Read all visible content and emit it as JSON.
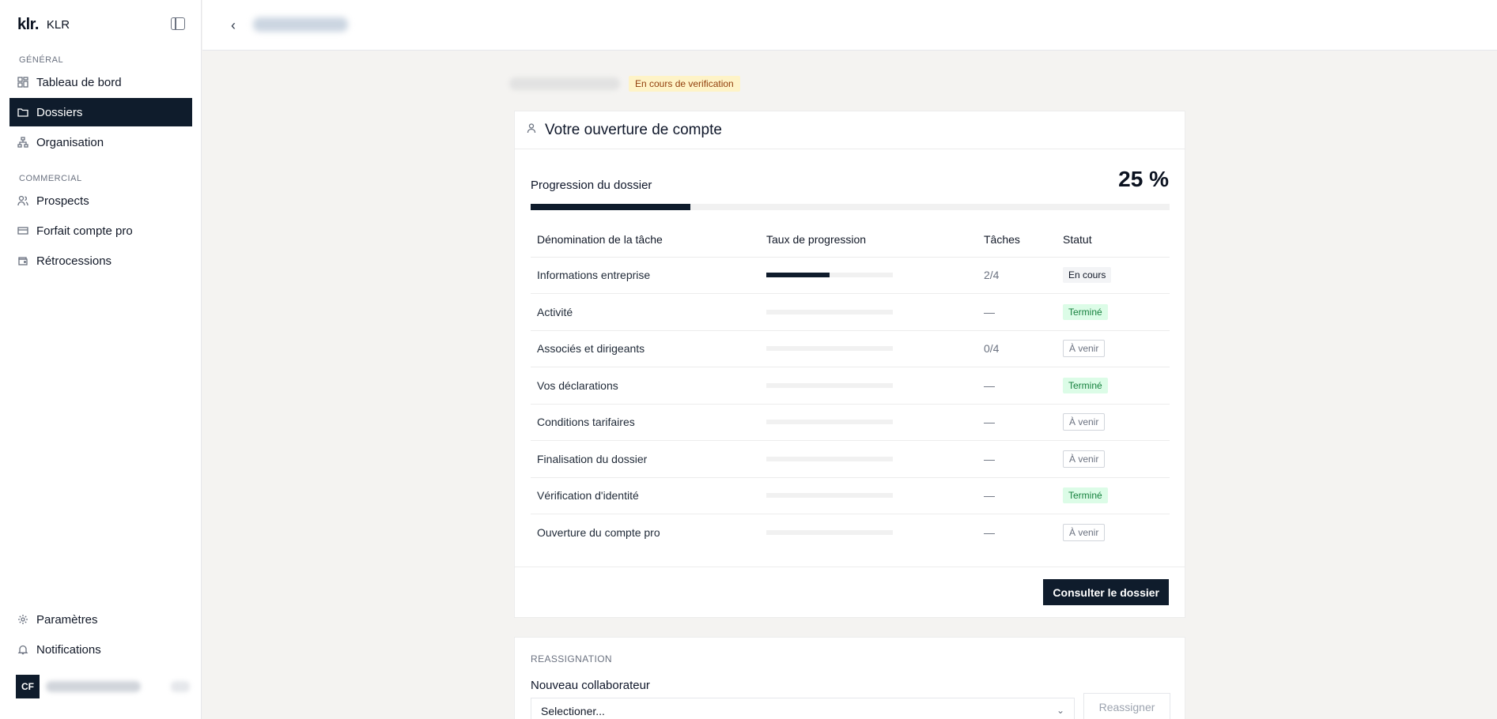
{
  "brand": {
    "logo": "klr.",
    "name": "KLR"
  },
  "sidebar": {
    "sections": [
      {
        "label": "GÉNÉRAL"
      },
      {
        "label": "COMMERCIAL"
      }
    ],
    "items": [
      {
        "label": "Tableau de bord",
        "icon": "dashboard-icon"
      },
      {
        "label": "Dossiers",
        "icon": "folder-icon"
      },
      {
        "label": "Organisation",
        "icon": "org-icon"
      },
      {
        "label": "Prospects",
        "icon": "users-icon"
      },
      {
        "label": "Forfait compte pro",
        "icon": "card-icon"
      },
      {
        "label": "Rétrocessions",
        "icon": "wallet-icon"
      }
    ],
    "bottom": [
      {
        "label": "Paramètres",
        "icon": "gear-icon"
      },
      {
        "label": "Notifications",
        "icon": "bell-icon"
      }
    ],
    "user": {
      "initials": "CF"
    }
  },
  "status_chip": "En cours de verification",
  "card": {
    "title": "Votre ouverture de compte",
    "progress_label": "Progression du dossier",
    "progress_text": "25 %",
    "progress_value": 0.25,
    "columns": [
      "Dénomination de la tâche",
      "Taux de progression",
      "Tâches",
      "Statut"
    ],
    "rows": [
      {
        "name": "Informations entreprise",
        "progress": 0.5,
        "tasks": "2/4",
        "status": "En cours",
        "kind": "progress"
      },
      {
        "name": "Activité",
        "progress": 0,
        "tasks": "—",
        "status": "Terminé",
        "kind": "done"
      },
      {
        "name": "Associés et dirigeants",
        "progress": 0,
        "tasks": "0/4",
        "status": "À venir",
        "kind": "upcoming"
      },
      {
        "name": "Vos déclarations",
        "progress": 0,
        "tasks": "—",
        "status": "Terminé",
        "kind": "done"
      },
      {
        "name": "Conditions tarifaires",
        "progress": 0,
        "tasks": "—",
        "status": "À venir",
        "kind": "upcoming"
      },
      {
        "name": "Finalisation du dossier",
        "progress": 0,
        "tasks": "—",
        "status": "À venir",
        "kind": "upcoming"
      },
      {
        "name": "Vérification d'identité",
        "progress": 0,
        "tasks": "—",
        "status": "Terminé",
        "kind": "done"
      },
      {
        "name": "Ouverture du compte pro",
        "progress": 0,
        "tasks": "—",
        "status": "À venir",
        "kind": "upcoming"
      }
    ],
    "button": "Consulter le dossier"
  },
  "reassign": {
    "section_label": "REASSIGNATION",
    "field_label": "Nouveau collaborateur",
    "select_value": "Selectioner...",
    "button": "Reassigner"
  },
  "colors": {
    "accent": "#0f1c2c",
    "done_bg": "#dcfce7",
    "done_text": "#15803d",
    "warning_bg": "#fef3c7",
    "warning_text": "#92400e"
  }
}
